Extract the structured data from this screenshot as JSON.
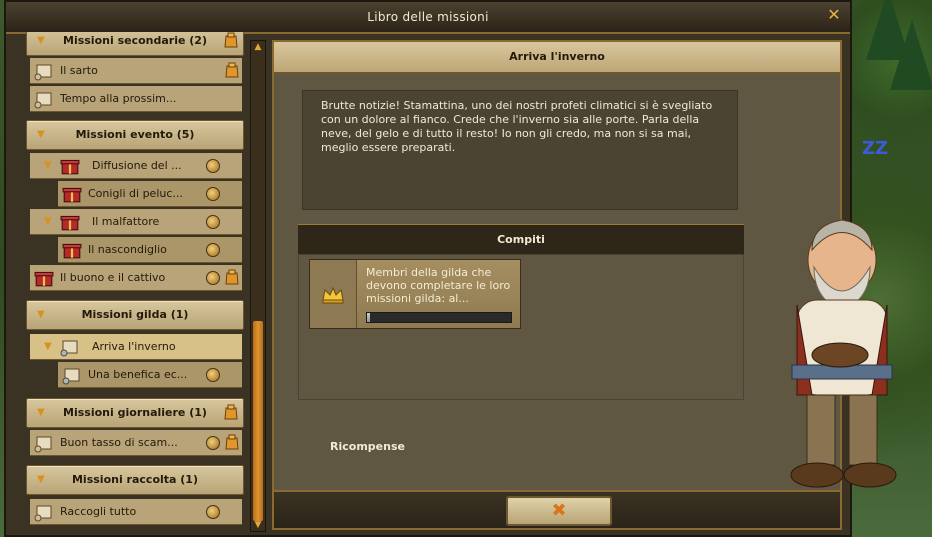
{
  "window": {
    "title": "Libro delle missioni"
  },
  "sidebar": {
    "sections": [
      {
        "label": "Missioni secondarie (2)"
      },
      {
        "label": "Missioni evento (5)"
      },
      {
        "label": "Missioni gilda (1)"
      },
      {
        "label": "Missioni giornaliere (1)"
      },
      {
        "label": "Missioni raccolta (1)"
      }
    ],
    "items": [
      {
        "label": "Il sarto"
      },
      {
        "label": "Tempo alla prossim..."
      },
      {
        "label": "Diffusione del ..."
      },
      {
        "label": "Conigli di peluc..."
      },
      {
        "label": "Il malfattore"
      },
      {
        "label": "Il nascondiglio"
      },
      {
        "label": "Il buono e il cattivo"
      },
      {
        "label": "Arriva l'inverno"
      },
      {
        "label": "Una benefica ec..."
      },
      {
        "label": "Buon tasso di scam..."
      },
      {
        "label": "Raccogli tutto"
      }
    ]
  },
  "quest": {
    "title": "Arriva l'inverno",
    "description": "Brutte notizie! Stamattina, uno dei nostri profeti climatici si è svegliato con un dolore al fianco. Crede che l'inverno sia alle porte. Parla della neve, del gelo e di tutto il resto! Io non gli credo, ma non si sa mai, meglio essere preparati.",
    "tasks_header": "Compiti",
    "task": {
      "text": "Membri della gilda che devono completare le loro missioni gilda: al...",
      "progress": 0.02
    },
    "rewards_label": "Ricompense",
    "close_label": "✖"
  },
  "icons": {
    "close": "close-icon",
    "crown": "crown-icon",
    "bag": "bag-icon",
    "scroll": "scroll-icon",
    "gift": "gift-icon",
    "sleep": "zz-icon"
  },
  "colors": {
    "accent": "#d9901c",
    "panel": "#5f5742",
    "header": "#d8c79e"
  }
}
